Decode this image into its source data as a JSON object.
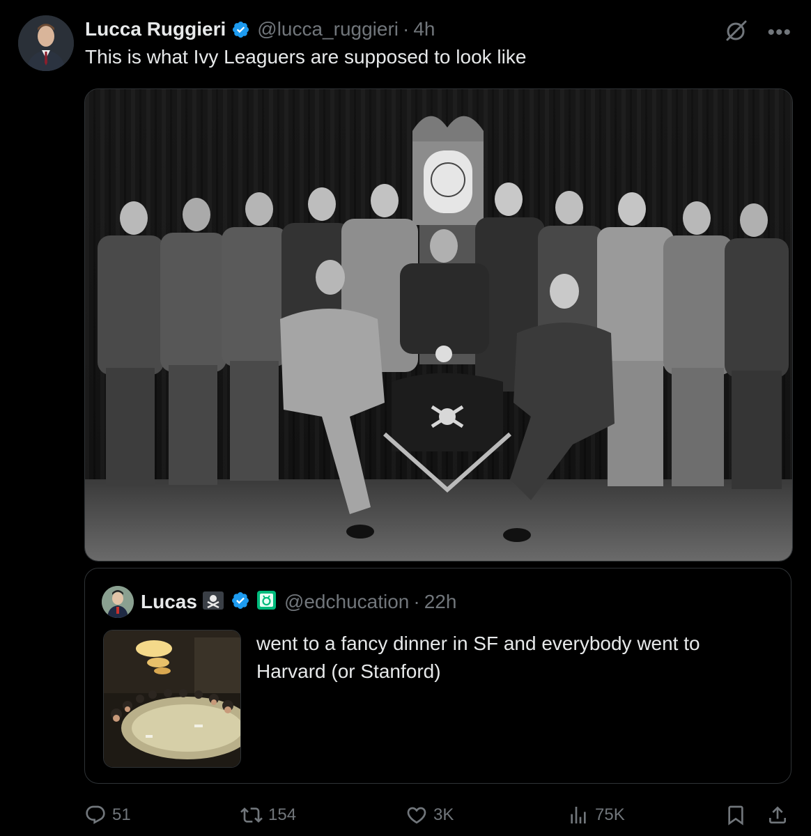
{
  "post": {
    "author": {
      "display_name": "Lucca Ruggieri",
      "handle": "@lucca_ruggieri",
      "time": "4h",
      "verified": true
    },
    "separator": "·",
    "text": "This is what Ivy Leaguers are supposed to look like",
    "image": {
      "kind": "black-and-white group photo"
    }
  },
  "quote": {
    "author": {
      "display_name": "Lucas",
      "emoji_icon": "skull-and-crossbones-flag-icon",
      "verified": true,
      "affiliation_icon": "green-affiliate-badge-icon",
      "handle": "@edchucation",
      "time": "22h"
    },
    "separator": "·",
    "text": "went to a fancy dinner in SF and everybody went to Harvard (or Stanford)"
  },
  "actions": {
    "replies": "51",
    "reposts": "154",
    "likes": "3K",
    "views": "75K"
  },
  "colors": {
    "background": "#000000",
    "text_primary": "#e7e9ea",
    "text_secondary": "#71767b",
    "border": "#2f3336",
    "verified_blue": "#1d9bf0",
    "affiliate_green": "#00ba7c"
  }
}
